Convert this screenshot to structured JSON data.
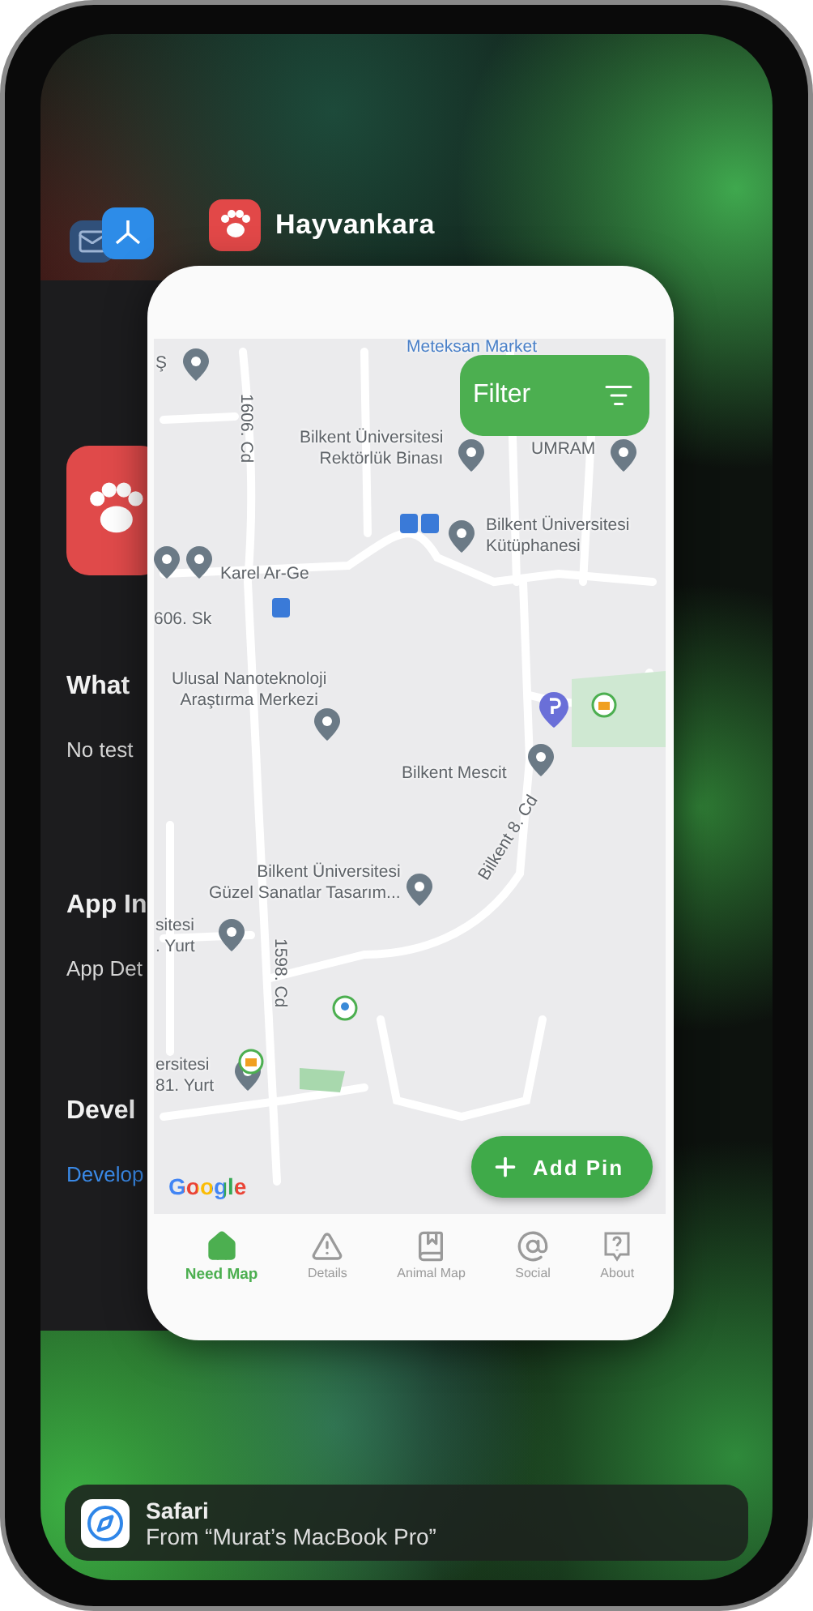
{
  "front_app": {
    "name": "Hayvankara"
  },
  "back_card": {
    "texts": [
      {
        "text": "What",
        "kind": "heading"
      },
      {
        "text": "No test",
        "kind": "body"
      },
      {
        "text": "App In",
        "kind": "heading"
      },
      {
        "text": "App Det",
        "kind": "body"
      },
      {
        "text": "Devel",
        "kind": "heading"
      },
      {
        "text": "Develop",
        "kind": "link"
      }
    ]
  },
  "map": {
    "labels": [
      {
        "lines": [
          "Meteksan Market"
        ],
        "kind": "poi"
      },
      {
        "lines": [
          "Ş"
        ],
        "kind": "place"
      },
      {
        "lines": [
          "Bilkent Üniversitesi",
          "Rektörlük Binası"
        ],
        "kind": "place"
      },
      {
        "lines": [
          "UMRAM"
        ],
        "kind": "place"
      },
      {
        "lines": [
          "1606. Cd"
        ],
        "kind": "road"
      },
      {
        "lines": [
          "Bilkent Üniversitesi",
          "Kütüphanesi"
        ],
        "kind": "place"
      },
      {
        "lines": [
          "Karel Ar-Ge"
        ],
        "kind": "place"
      },
      {
        "lines": [
          "606. Sk"
        ],
        "kind": "road"
      },
      {
        "lines": [
          "Ulusal Nanoteknoloji",
          "Araştırma Merkezi"
        ],
        "kind": "place"
      },
      {
        "lines": [
          "Bilkent Mescit"
        ],
        "kind": "place"
      },
      {
        "lines": [
          "Bilkent Üniversitesi",
          "Güzel Sanatlar Tasarım..."
        ],
        "kind": "place"
      },
      {
        "lines": [
          "Bilkent 8. Cd"
        ],
        "kind": "road"
      },
      {
        "lines": [
          "sitesi",
          ". Yurt"
        ],
        "kind": "place"
      },
      {
        "lines": [
          "1598. Cd"
        ],
        "kind": "road"
      },
      {
        "lines": [
          "ersitesi",
          "81. Yurt"
        ],
        "kind": "place"
      }
    ],
    "filter_button": "Filter",
    "add_pin_button": "Add Pin",
    "attribution": "Google"
  },
  "tabs": [
    {
      "label": "Need Map",
      "selected": true
    },
    {
      "label": "Details",
      "selected": false
    },
    {
      "label": "Animal Map",
      "selected": false
    },
    {
      "label": "Social",
      "selected": false
    },
    {
      "label": "About",
      "selected": false
    }
  ],
  "handoff_banner": {
    "app": "Safari",
    "source": "From “Murat’s MacBook Pro”"
  }
}
